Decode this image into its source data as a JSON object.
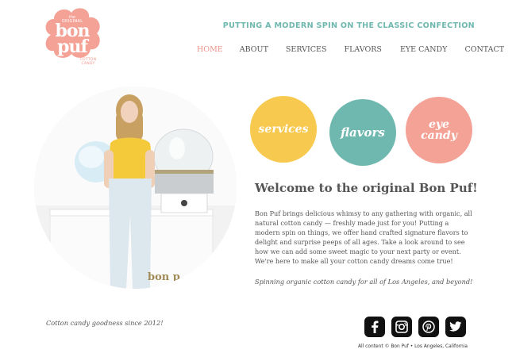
{
  "logo": {
    "the": "the",
    "original": "ORIGINAL",
    "bon": "bon",
    "puf": "puf",
    "cotton": "COTTON",
    "candy": "CANDY"
  },
  "header": {
    "tagline": "PUTTING A MODERN SPIN ON THE CLASSIC CONFECTION"
  },
  "nav": {
    "items": [
      {
        "label": "HOME",
        "active": true
      },
      {
        "label": "ABOUT"
      },
      {
        "label": "SERVICES"
      },
      {
        "label": "FLAVORS"
      },
      {
        "label": "EYE CANDY"
      },
      {
        "label": "CONTACT"
      }
    ]
  },
  "photo": {
    "machine_label": "bon p"
  },
  "circles": {
    "services": "services",
    "flavors": "flavors",
    "eye_candy": "eye candy"
  },
  "main": {
    "welcome": "Welcome to the original Bon Puf!",
    "intro": "Bon Puf brings delicious whimsy to any gathering with organic, all natural cotton candy — freshly made just for you! Putting a modern spin on things, we offer hand crafted signature flavors to delight and surprise peeps of all ages. Take a look around to see how we can add some sweet magic to your next party or event. We're here to make all your cotton candy dreams come true!",
    "spin": "Spinning organic cotton candy for all of Los Angeles, and beyond!"
  },
  "footer": {
    "since": "Cotton candy goodness since 2012!",
    "copyright": "All content © Bon Puf • Los Angeles, California",
    "social": [
      "facebook-icon",
      "instagram-icon",
      "pinterest-icon",
      "twitter-icon"
    ]
  },
  "colors": {
    "pink": "#f0958a",
    "teal": "#6fb8b0",
    "yellow": "#f7c94e",
    "coral": "#f4a196"
  }
}
